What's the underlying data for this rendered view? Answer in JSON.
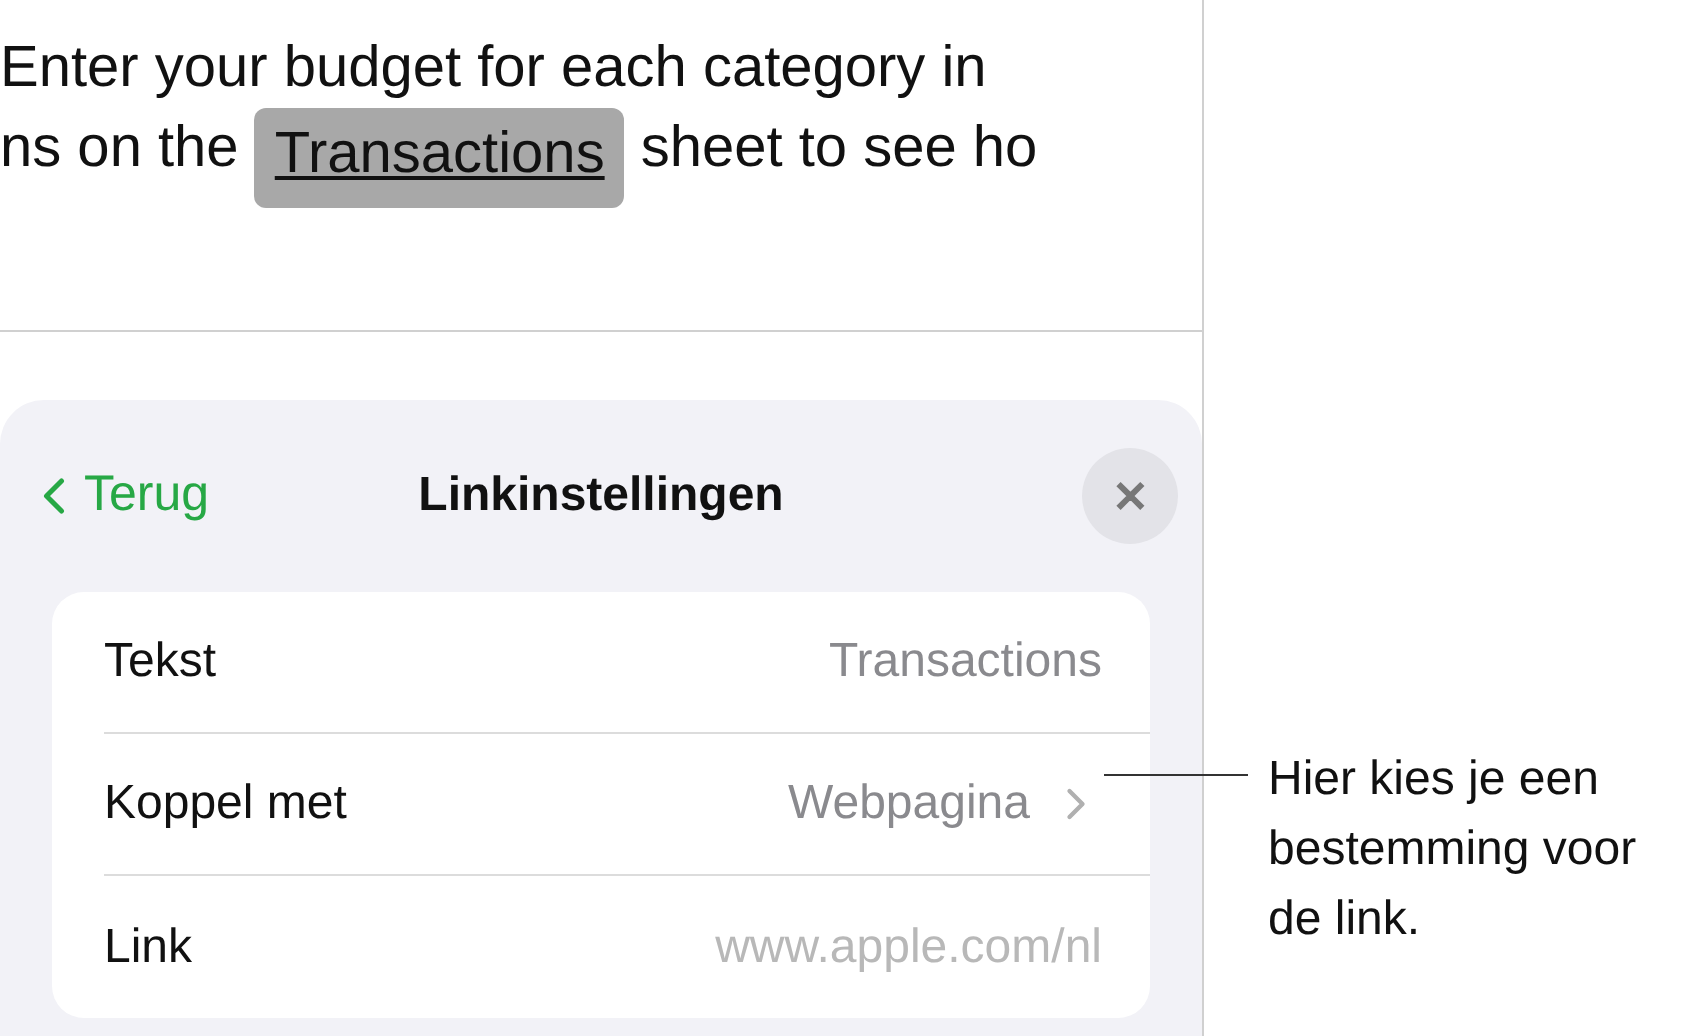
{
  "document": {
    "lines": [
      {
        "parts": [
          {
            "text": "Enter your budget for each category in",
            "selected": false
          }
        ]
      },
      {
        "parts": [
          {
            "text": "ns on the ",
            "selected": false
          },
          {
            "text": "Transactions",
            "selected": true
          },
          {
            "text": " sheet to see ho",
            "selected": false
          }
        ]
      }
    ]
  },
  "panel": {
    "back": "Terug",
    "title": "Linkinstellingen",
    "close": "✕",
    "rows": [
      {
        "label": "Tekst",
        "value": "Transactions",
        "kind": "text"
      },
      {
        "label": "Koppel met",
        "value": "Webpagina",
        "kind": "disclosure"
      },
      {
        "label": "Link",
        "value": "www.apple.com/nl",
        "kind": "placeholder"
      }
    ]
  },
  "callout": {
    "text": "Hier kies je een bestemming voor de link."
  }
}
